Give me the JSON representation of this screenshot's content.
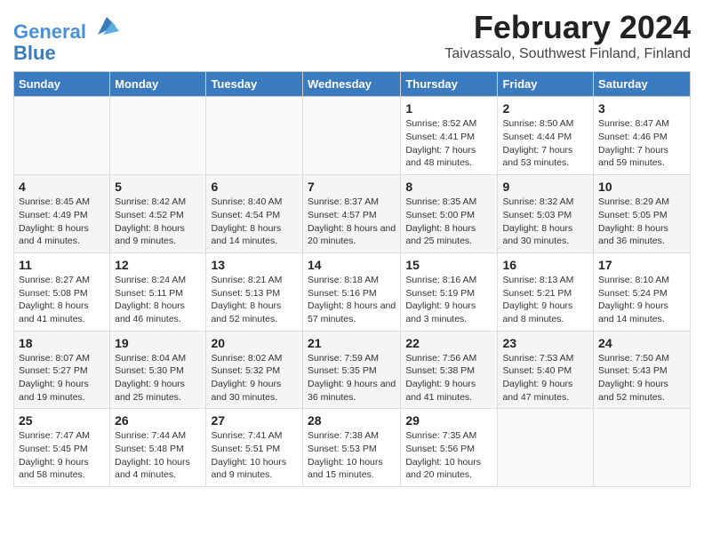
{
  "logo": {
    "line1": "General",
    "line2": "Blue"
  },
  "title": "February 2024",
  "subtitle": "Taivassalo, Southwest Finland, Finland",
  "columns": [
    "Sunday",
    "Monday",
    "Tuesday",
    "Wednesday",
    "Thursday",
    "Friday",
    "Saturday"
  ],
  "weeks": [
    [
      {
        "day": "",
        "info": ""
      },
      {
        "day": "",
        "info": ""
      },
      {
        "day": "",
        "info": ""
      },
      {
        "day": "",
        "info": ""
      },
      {
        "day": "1",
        "info": "Sunrise: 8:52 AM\nSunset: 4:41 PM\nDaylight: 7 hours and 48 minutes."
      },
      {
        "day": "2",
        "info": "Sunrise: 8:50 AM\nSunset: 4:44 PM\nDaylight: 7 hours and 53 minutes."
      },
      {
        "day": "3",
        "info": "Sunrise: 8:47 AM\nSunset: 4:46 PM\nDaylight: 7 hours and 59 minutes."
      }
    ],
    [
      {
        "day": "4",
        "info": "Sunrise: 8:45 AM\nSunset: 4:49 PM\nDaylight: 8 hours and 4 minutes."
      },
      {
        "day": "5",
        "info": "Sunrise: 8:42 AM\nSunset: 4:52 PM\nDaylight: 8 hours and 9 minutes."
      },
      {
        "day": "6",
        "info": "Sunrise: 8:40 AM\nSunset: 4:54 PM\nDaylight: 8 hours and 14 minutes."
      },
      {
        "day": "7",
        "info": "Sunrise: 8:37 AM\nSunset: 4:57 PM\nDaylight: 8 hours and 20 minutes."
      },
      {
        "day": "8",
        "info": "Sunrise: 8:35 AM\nSunset: 5:00 PM\nDaylight: 8 hours and 25 minutes."
      },
      {
        "day": "9",
        "info": "Sunrise: 8:32 AM\nSunset: 5:03 PM\nDaylight: 8 hours and 30 minutes."
      },
      {
        "day": "10",
        "info": "Sunrise: 8:29 AM\nSunset: 5:05 PM\nDaylight: 8 hours and 36 minutes."
      }
    ],
    [
      {
        "day": "11",
        "info": "Sunrise: 8:27 AM\nSunset: 5:08 PM\nDaylight: 8 hours and 41 minutes."
      },
      {
        "day": "12",
        "info": "Sunrise: 8:24 AM\nSunset: 5:11 PM\nDaylight: 8 hours and 46 minutes."
      },
      {
        "day": "13",
        "info": "Sunrise: 8:21 AM\nSunset: 5:13 PM\nDaylight: 8 hours and 52 minutes."
      },
      {
        "day": "14",
        "info": "Sunrise: 8:18 AM\nSunset: 5:16 PM\nDaylight: 8 hours and 57 minutes."
      },
      {
        "day": "15",
        "info": "Sunrise: 8:16 AM\nSunset: 5:19 PM\nDaylight: 9 hours and 3 minutes."
      },
      {
        "day": "16",
        "info": "Sunrise: 8:13 AM\nSunset: 5:21 PM\nDaylight: 9 hours and 8 minutes."
      },
      {
        "day": "17",
        "info": "Sunrise: 8:10 AM\nSunset: 5:24 PM\nDaylight: 9 hours and 14 minutes."
      }
    ],
    [
      {
        "day": "18",
        "info": "Sunrise: 8:07 AM\nSunset: 5:27 PM\nDaylight: 9 hours and 19 minutes."
      },
      {
        "day": "19",
        "info": "Sunrise: 8:04 AM\nSunset: 5:30 PM\nDaylight: 9 hours and 25 minutes."
      },
      {
        "day": "20",
        "info": "Sunrise: 8:02 AM\nSunset: 5:32 PM\nDaylight: 9 hours and 30 minutes."
      },
      {
        "day": "21",
        "info": "Sunrise: 7:59 AM\nSunset: 5:35 PM\nDaylight: 9 hours and 36 minutes."
      },
      {
        "day": "22",
        "info": "Sunrise: 7:56 AM\nSunset: 5:38 PM\nDaylight: 9 hours and 41 minutes."
      },
      {
        "day": "23",
        "info": "Sunrise: 7:53 AM\nSunset: 5:40 PM\nDaylight: 9 hours and 47 minutes."
      },
      {
        "day": "24",
        "info": "Sunrise: 7:50 AM\nSunset: 5:43 PM\nDaylight: 9 hours and 52 minutes."
      }
    ],
    [
      {
        "day": "25",
        "info": "Sunrise: 7:47 AM\nSunset: 5:45 PM\nDaylight: 9 hours and 58 minutes."
      },
      {
        "day": "26",
        "info": "Sunrise: 7:44 AM\nSunset: 5:48 PM\nDaylight: 10 hours and 4 minutes."
      },
      {
        "day": "27",
        "info": "Sunrise: 7:41 AM\nSunset: 5:51 PM\nDaylight: 10 hours and 9 minutes."
      },
      {
        "day": "28",
        "info": "Sunrise: 7:38 AM\nSunset: 5:53 PM\nDaylight: 10 hours and 15 minutes."
      },
      {
        "day": "29",
        "info": "Sunrise: 7:35 AM\nSunset: 5:56 PM\nDaylight: 10 hours and 20 minutes."
      },
      {
        "day": "",
        "info": ""
      },
      {
        "day": "",
        "info": ""
      }
    ]
  ]
}
